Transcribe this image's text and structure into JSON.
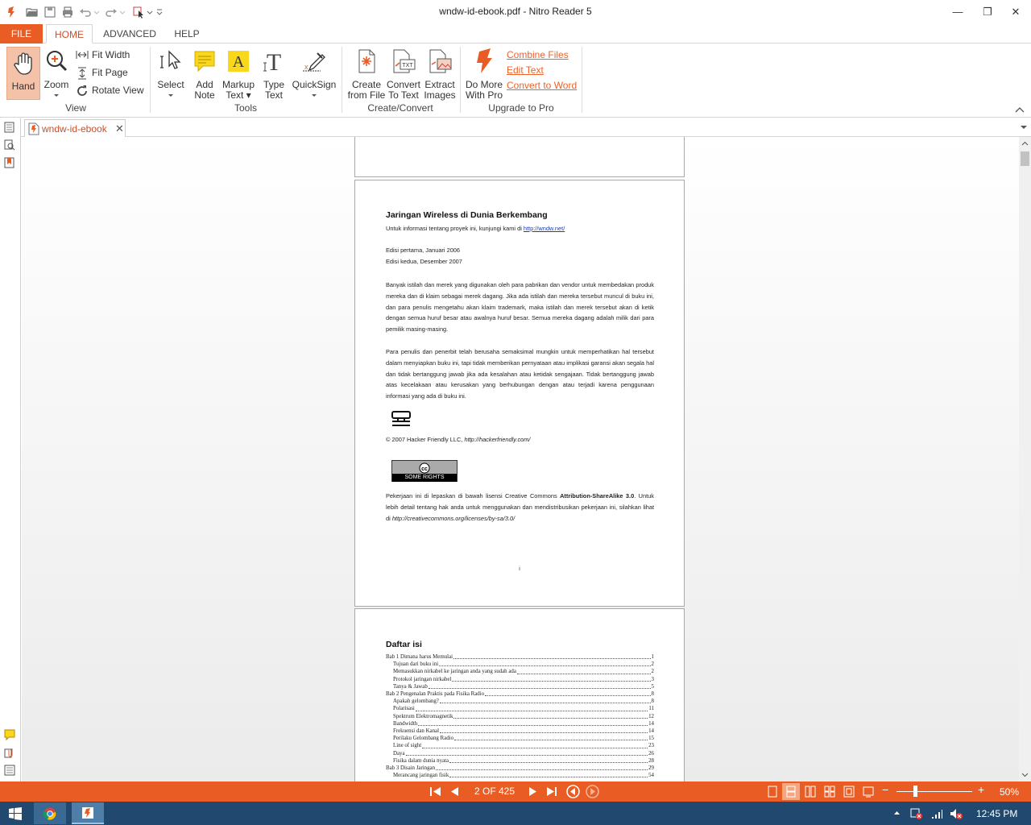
{
  "window": {
    "title": "wndw-id-ebook.pdf - Nitro Reader 5",
    "minimize": "—",
    "maximize": "❐",
    "close": "✕"
  },
  "ribbon_tabs": {
    "file": "FILE",
    "home": "HOME",
    "advanced": "ADVANCED",
    "help": "HELP"
  },
  "ribbon": {
    "hand": "Hand",
    "zoom": "Zoom",
    "fit_width": "Fit Width",
    "fit_page": "Fit Page",
    "rotate_view": "Rotate View",
    "view_group": "View",
    "select": "Select",
    "add_note_1": "Add",
    "add_note_2": "Note",
    "markup_1": "Markup",
    "markup_2": "Text",
    "type_1": "Type",
    "type_2": "Text",
    "quicksign": "QuickSign",
    "tools_group": "Tools",
    "create_1": "Create",
    "create_2": "from File",
    "convert_1": "Convert",
    "convert_2": "To Text",
    "extract_1": "Extract",
    "extract_2": "Images",
    "create_group": "Create/Convert",
    "domore_1": "Do More",
    "domore_2": "With Pro",
    "combine": "Combine Files",
    "edit_text": "Edit Text",
    "convert_word": "Convert to Word",
    "upgrade_group": "Upgrade to Pro"
  },
  "document_tab": {
    "label": "wndw-id-ebook"
  },
  "page2": {
    "title": "Jaringan Wireless di Dunia Berkembang",
    "info_prefix": "Untuk informasi tentang proyek ini, kunjungi kami di ",
    "info_link": "http://wndw.net/",
    "edition1": "Edisi pertama, Januari 2006",
    "edition2": "Edisi kedua, Desember 2007",
    "para1": "Banyak istilah dan merek yang digunakan oleh para pabrikan dan vendor untuk membedakan produk mereka dan di klaim sebagai merek dagang. Jika ada istilah dan mereka tersebut muncul di buku ini, dan para penulis mengetahu akan klaim trademark, maka istilah dan merek tersebut akan di ketik dengan semua huruf besar atau awalnya huruf besar. Semua mereka dagang adalah milik dari para pemilik masing-masing.",
    "para2": "Para penulis dan penerbit telah berusaha semaksimal mungkin untuk memperhatikan hal tersebut dalam menyiapkan buku ini, tapi tidak memberikan pernyataan atau implikasi garansi akan segala hal dan tidak bertanggung jawab jika ada kesalahan atau ketidak sengajaan. Tidak bertanggung jawab atas kecelakaan atau kerusakan yang berhubungan dengan atau terjadi karena penggunaan informasi yang ada di buku ini.",
    "copyright": "© 2007 Hacker Friendly LLC, ",
    "copyright_url": "http://hackerfriendly.com/",
    "cc_text": "SOME RIGHTS RESERVED",
    "license_a": "Pekerjaan ini di lepaskan di bawah lisensi  Creative Commons ",
    "license_b": "Attribution-ShareAlike 3.0",
    "license_c": ". Untuk lebih detail tentang hak anda untuk menggunakan dan mendistribusikan pekerjaan ini, silahkan lihat di ",
    "license_url": "http://creativecommons.org/licenses/by-sa/3.0/",
    "page_num": "i"
  },
  "page3": {
    "title": "Daftar isi",
    "toc": [
      {
        "text": "Bab 1 Dimana harus Memulai",
        "page": "1",
        "level": 0
      },
      {
        "text": "Tujuan dari buku ini",
        "page": "2",
        "level": 1
      },
      {
        "text": "Memasukkan nirkabel ke jaringan anda yang sudah ada",
        "page": "2",
        "level": 1
      },
      {
        "text": "Protokol jaringan nirkabel",
        "page": "3",
        "level": 1
      },
      {
        "text": "Tanya & Jawab",
        "page": "5",
        "level": 1
      },
      {
        "text": "Bab 2 Pengenalan Praktis pada Fisika Radio",
        "page": "8",
        "level": 0
      },
      {
        "text": "Apakah gelombang?",
        "page": "8",
        "level": 1
      },
      {
        "text": "Polarisasi",
        "page": "11",
        "level": 1
      },
      {
        "text": "Spektrum Elektromagnetik",
        "page": "12",
        "level": 1
      },
      {
        "text": "Bandwidth",
        "page": "14",
        "level": 1
      },
      {
        "text": "Frekuensi dan Kanal",
        "page": "14",
        "level": 1
      },
      {
        "text": "Perilaku Gelombang Radio",
        "page": "15",
        "level": 1
      },
      {
        "text": "Line of sight",
        "page": "23",
        "level": 1
      },
      {
        "text": "Daya",
        "page": "26",
        "level": 1
      },
      {
        "text": "Fisika dalam dunia nyata",
        "page": "28",
        "level": 1
      },
      {
        "text": "Bab 3 Disain Jaringan",
        "page": "29",
        "level": 0
      },
      {
        "text": "Merancang jaringan fisik",
        "page": "54",
        "level": 1
      }
    ]
  },
  "statusbar": {
    "page_indicator": "2 OF 425",
    "zoom": "50%"
  },
  "taskbar": {
    "time": "12:45 PM"
  },
  "colors": {
    "accent": "#e95d25",
    "taskbar": "#21496f"
  }
}
